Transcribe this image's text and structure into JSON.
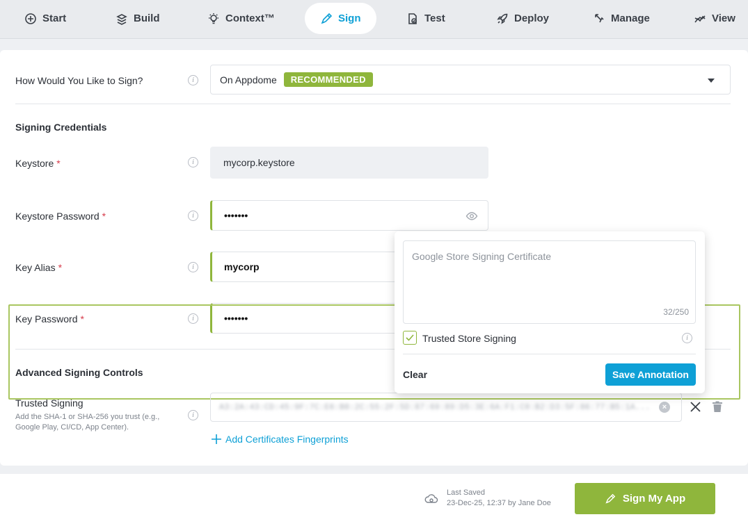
{
  "nav": {
    "items": [
      {
        "label": "Start",
        "icon": "plus-circle-icon"
      },
      {
        "label": "Build",
        "icon": "build-icon"
      },
      {
        "label": "Context™",
        "icon": "lightbulb-icon"
      },
      {
        "label": "Sign",
        "icon": "pen-icon",
        "active": true
      },
      {
        "label": "Test",
        "icon": "test-icon"
      },
      {
        "label": "Deploy",
        "icon": "rocket-icon"
      },
      {
        "label": "Manage",
        "icon": "manage-icon"
      },
      {
        "label": "View",
        "icon": "chart-icon"
      }
    ]
  },
  "sign_method": {
    "label": "How Would You Like to Sign?",
    "value": "On Appdome",
    "badge": "RECOMMENDED"
  },
  "credentials": {
    "title": "Signing Credentials",
    "keystore": {
      "label": "Keystore",
      "value": "mycorp.keystore"
    },
    "keystore_password": {
      "label": "Keystore Password",
      "value": "•••••••"
    },
    "key_alias": {
      "label": "Key Alias",
      "value": "mycorp"
    },
    "key_password": {
      "label": "Key Password",
      "value": "•••••••"
    },
    "required_mark": "*"
  },
  "advanced": {
    "title": "Advanced Signing Controls",
    "trusted_label": "Trusted Signing",
    "help_text": "Add the SHA-1 or SHA-256 you trust (e.g., Google Play, CI/CD, App Center).",
    "fingerprint": "A3:2A:43:CD:45:9F:7C:E6:B8:2C:55:2F:5D:87:69:89:D5:3E:6A:F1:C0:B2:D3:5F:86:77:B5:1A...",
    "add_link": "Add Certificates Fingerprints"
  },
  "popover": {
    "placeholder": "Google Store Signing Certificate",
    "counter": "32/250",
    "checkbox_label": "Trusted Store Signing",
    "clear_label": "Clear",
    "save_label": "Save Annotation"
  },
  "footer": {
    "last_saved_label": "Last Saved",
    "last_saved_value": "23-Dec-25, 12:37 by Jane Doe",
    "sign_button": "Sign My App"
  },
  "colors": {
    "accent_green": "#8fb63c",
    "accent_blue": "#0ea0d6",
    "required_red": "#d63a4a"
  }
}
